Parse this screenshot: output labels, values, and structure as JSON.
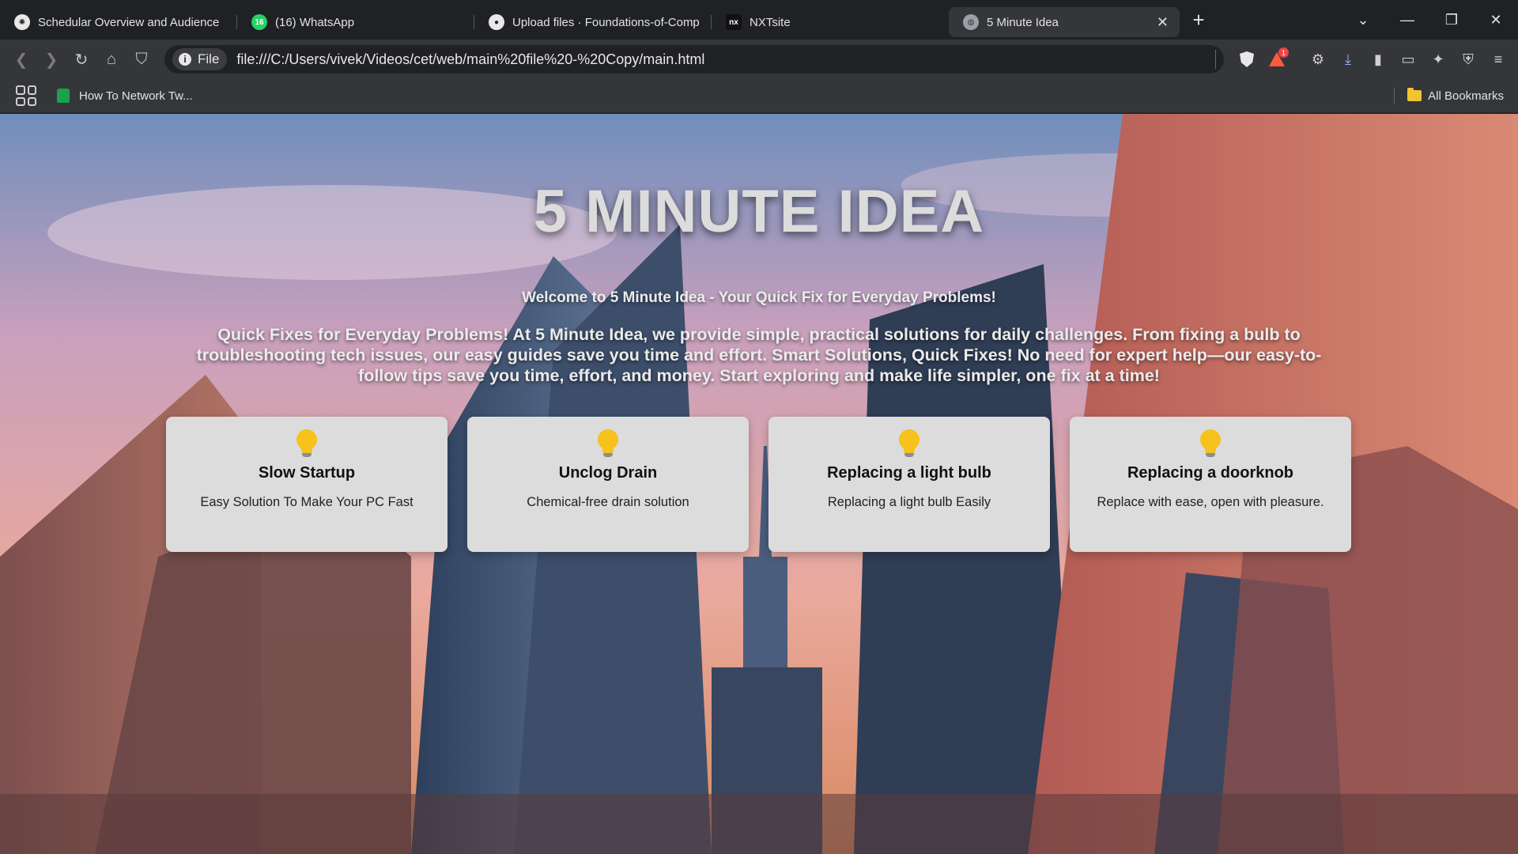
{
  "tabs": [
    {
      "label": "Schedular Overview and Audience",
      "icon": "openai-icon",
      "active": false
    },
    {
      "label": "(16) WhatsApp",
      "icon": "whatsapp-icon",
      "badge": "16",
      "active": false
    },
    {
      "label": "Upload files · Foundations-of-Comp",
      "icon": "github-icon",
      "active": false
    },
    {
      "label": "NXTsite",
      "icon": "nxt-icon",
      "active": false
    },
    {
      "label": "5 Minute Idea",
      "icon": "globe-icon",
      "active": true
    }
  ],
  "toolbar": {
    "chip_label": "File",
    "url": "file:///C:/Users/vivek/Videos/cet/web/main%20file%20-%20Copy/main.html",
    "brave_rewards_badge": "1"
  },
  "bookmarks": {
    "items": [
      {
        "label": "How To Network Tw..."
      }
    ],
    "all_bookmarks": "All Bookmarks"
  },
  "page": {
    "title": "5 MINUTE IDEA",
    "welcome": "Welcome to 5 Minute Idea - Your Quick Fix for Everyday Problems!",
    "intro": "Quick Fixes for Everyday Problems! At 5 Minute Idea, we provide simple, practical solutions for daily challenges. From fixing a bulb to troubleshooting tech issues, our easy guides save you time and effort. Smart Solutions, Quick Fixes! No need for expert help—our easy-to-follow tips save you time, effort, and money. Start exploring and make life simpler, one fix at a time!",
    "cards": [
      {
        "title": "Slow Startup",
        "desc": "Easy Solution To Make Your PC Fast",
        "icon": "light-bulb-icon"
      },
      {
        "title": "Unclog Drain",
        "desc": "Chemical-free drain solution",
        "icon": "light-bulb-icon"
      },
      {
        "title": "Replacing a light bulb",
        "desc": "Replacing a light bulb Easily",
        "icon": "light-bulb-icon"
      },
      {
        "title": "Replacing a doorknob",
        "desc": "Replace with ease, open with pleasure.",
        "icon": "light-bulb-icon"
      }
    ]
  },
  "colors": {
    "card_bg": "#dcdcdc",
    "bulb": "#f6c21b",
    "tabbar_bg": "#202124",
    "toolbar_bg": "#35363a"
  }
}
